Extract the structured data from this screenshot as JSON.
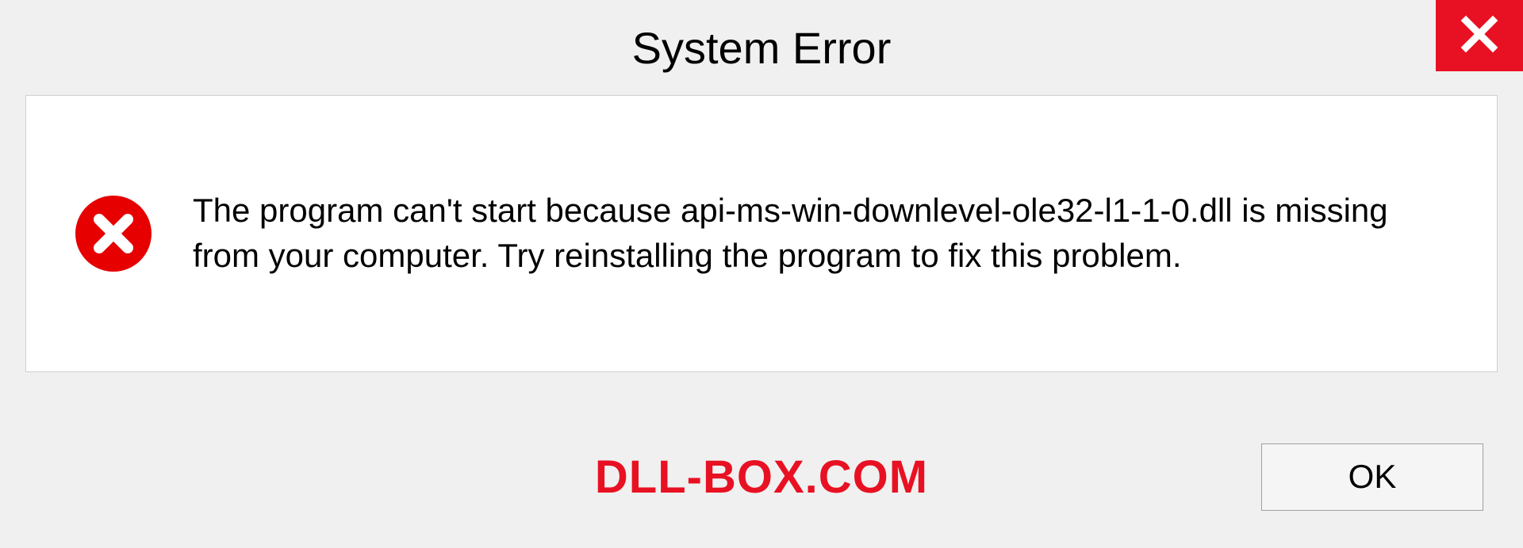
{
  "titlebar": {
    "title": "System Error",
    "close_icon": "close-icon"
  },
  "content": {
    "error_icon": "error-circle-x-icon",
    "message": "The program can't start because api-ms-win-downlevel-ole32-l1-1-0.dll is missing from your computer. Try reinstalling the program to fix this problem."
  },
  "footer": {
    "watermark": "DLL-BOX.COM",
    "ok_label": "OK"
  },
  "colors": {
    "accent_red": "#e81123",
    "panel_bg": "#ffffff",
    "window_bg": "#f0f0f0",
    "border": "#d0d0d0"
  }
}
